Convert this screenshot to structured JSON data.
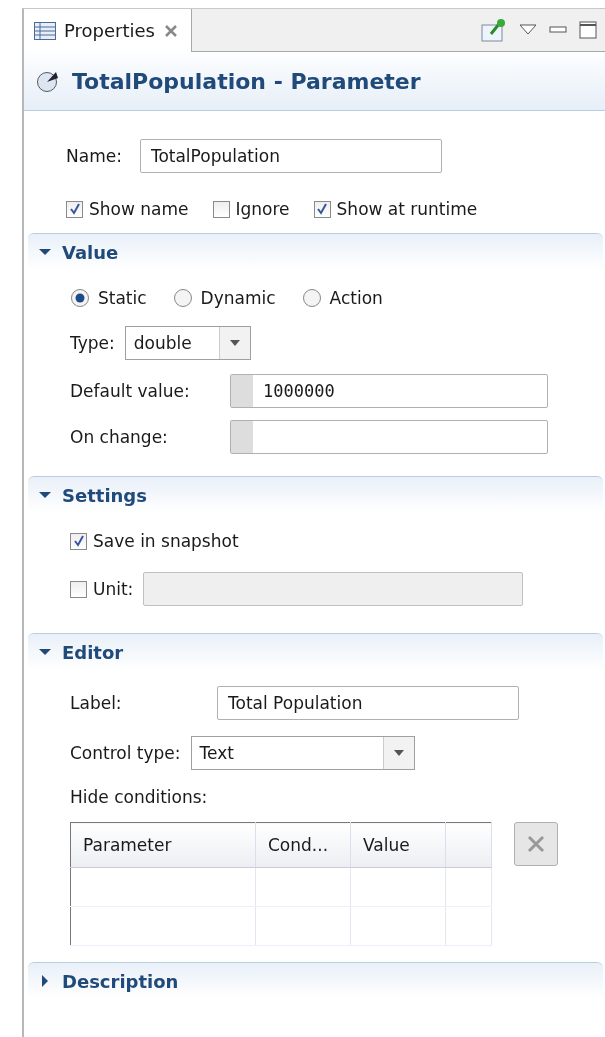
{
  "tab": {
    "label": "Properties"
  },
  "title": "TotalPopulation - Parameter",
  "name": {
    "label": "Name:",
    "value": "TotalPopulation"
  },
  "flags": [
    {
      "label": "Show name",
      "checked": true
    },
    {
      "label": "Ignore",
      "checked": false
    },
    {
      "label": "Show at runtime",
      "checked": true
    }
  ],
  "sections": [
    {
      "title": "Value",
      "expanded": true,
      "rows": [
        {
          "kind": "radios",
          "options": [
            {
              "label": "Static",
              "selected": true
            },
            {
              "label": "Dynamic",
              "selected": false
            },
            {
              "label": "Action",
              "selected": false
            }
          ]
        },
        {
          "kind": "dropdown",
          "label": "Type:",
          "value": "double"
        },
        {
          "kind": "code",
          "label": "Default value:",
          "value": "1000000"
        },
        {
          "kind": "code",
          "label": "On change:"
        }
      ]
    },
    {
      "title": "Settings",
      "expanded": true,
      "rows": [
        {
          "kind": "checkbox",
          "label": "Save in snapshot",
          "checked": true
        },
        {
          "kind": "checkfield",
          "label": "Unit:",
          "checked": false
        }
      ]
    },
    {
      "title": "Editor",
      "expanded": true,
      "rows": [
        {
          "kind": "text",
          "label": "Label:",
          "value": "Total Population"
        },
        {
          "kind": "dropdown",
          "label": "Control type:",
          "value": "Text"
        },
        {
          "kind": "caption",
          "label": "Hide conditions:"
        },
        {
          "kind": "table",
          "columns": [
            "Parameter",
            "Cond...",
            "Value"
          ]
        }
      ]
    },
    {
      "title": "Description",
      "expanded": false
    }
  ]
}
